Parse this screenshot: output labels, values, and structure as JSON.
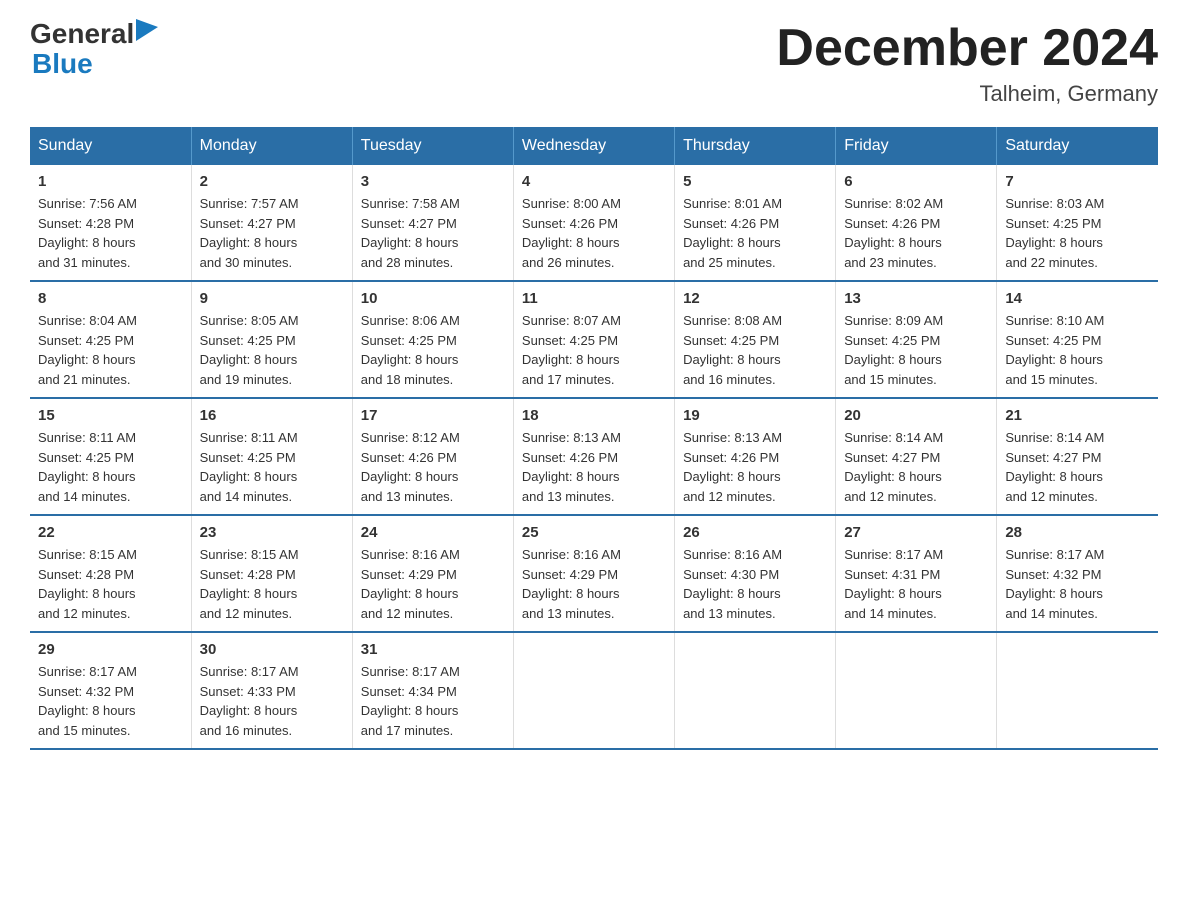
{
  "logo": {
    "general": "General",
    "blue": "Blue"
  },
  "title": "December 2024",
  "subtitle": "Talheim, Germany",
  "days_of_week": [
    "Sunday",
    "Monday",
    "Tuesday",
    "Wednesday",
    "Thursday",
    "Friday",
    "Saturday"
  ],
  "weeks": [
    [
      {
        "day": "1",
        "sunrise": "7:56 AM",
        "sunset": "4:28 PM",
        "daylight": "8 hours and 31 minutes."
      },
      {
        "day": "2",
        "sunrise": "7:57 AM",
        "sunset": "4:27 PM",
        "daylight": "8 hours and 30 minutes."
      },
      {
        "day": "3",
        "sunrise": "7:58 AM",
        "sunset": "4:27 PM",
        "daylight": "8 hours and 28 minutes."
      },
      {
        "day": "4",
        "sunrise": "8:00 AM",
        "sunset": "4:26 PM",
        "daylight": "8 hours and 26 minutes."
      },
      {
        "day": "5",
        "sunrise": "8:01 AM",
        "sunset": "4:26 PM",
        "daylight": "8 hours and 25 minutes."
      },
      {
        "day": "6",
        "sunrise": "8:02 AM",
        "sunset": "4:26 PM",
        "daylight": "8 hours and 23 minutes."
      },
      {
        "day": "7",
        "sunrise": "8:03 AM",
        "sunset": "4:25 PM",
        "daylight": "8 hours and 22 minutes."
      }
    ],
    [
      {
        "day": "8",
        "sunrise": "8:04 AM",
        "sunset": "4:25 PM",
        "daylight": "8 hours and 21 minutes."
      },
      {
        "day": "9",
        "sunrise": "8:05 AM",
        "sunset": "4:25 PM",
        "daylight": "8 hours and 19 minutes."
      },
      {
        "day": "10",
        "sunrise": "8:06 AM",
        "sunset": "4:25 PM",
        "daylight": "8 hours and 18 minutes."
      },
      {
        "day": "11",
        "sunrise": "8:07 AM",
        "sunset": "4:25 PM",
        "daylight": "8 hours and 17 minutes."
      },
      {
        "day": "12",
        "sunrise": "8:08 AM",
        "sunset": "4:25 PM",
        "daylight": "8 hours and 16 minutes."
      },
      {
        "day": "13",
        "sunrise": "8:09 AM",
        "sunset": "4:25 PM",
        "daylight": "8 hours and 15 minutes."
      },
      {
        "day": "14",
        "sunrise": "8:10 AM",
        "sunset": "4:25 PM",
        "daylight": "8 hours and 15 minutes."
      }
    ],
    [
      {
        "day": "15",
        "sunrise": "8:11 AM",
        "sunset": "4:25 PM",
        "daylight": "8 hours and 14 minutes."
      },
      {
        "day": "16",
        "sunrise": "8:11 AM",
        "sunset": "4:25 PM",
        "daylight": "8 hours and 14 minutes."
      },
      {
        "day": "17",
        "sunrise": "8:12 AM",
        "sunset": "4:26 PM",
        "daylight": "8 hours and 13 minutes."
      },
      {
        "day": "18",
        "sunrise": "8:13 AM",
        "sunset": "4:26 PM",
        "daylight": "8 hours and 13 minutes."
      },
      {
        "day": "19",
        "sunrise": "8:13 AM",
        "sunset": "4:26 PM",
        "daylight": "8 hours and 12 minutes."
      },
      {
        "day": "20",
        "sunrise": "8:14 AM",
        "sunset": "4:27 PM",
        "daylight": "8 hours and 12 minutes."
      },
      {
        "day": "21",
        "sunrise": "8:14 AM",
        "sunset": "4:27 PM",
        "daylight": "8 hours and 12 minutes."
      }
    ],
    [
      {
        "day": "22",
        "sunrise": "8:15 AM",
        "sunset": "4:28 PM",
        "daylight": "8 hours and 12 minutes."
      },
      {
        "day": "23",
        "sunrise": "8:15 AM",
        "sunset": "4:28 PM",
        "daylight": "8 hours and 12 minutes."
      },
      {
        "day": "24",
        "sunrise": "8:16 AM",
        "sunset": "4:29 PM",
        "daylight": "8 hours and 12 minutes."
      },
      {
        "day": "25",
        "sunrise": "8:16 AM",
        "sunset": "4:29 PM",
        "daylight": "8 hours and 13 minutes."
      },
      {
        "day": "26",
        "sunrise": "8:16 AM",
        "sunset": "4:30 PM",
        "daylight": "8 hours and 13 minutes."
      },
      {
        "day": "27",
        "sunrise": "8:17 AM",
        "sunset": "4:31 PM",
        "daylight": "8 hours and 14 minutes."
      },
      {
        "day": "28",
        "sunrise": "8:17 AM",
        "sunset": "4:32 PM",
        "daylight": "8 hours and 14 minutes."
      }
    ],
    [
      {
        "day": "29",
        "sunrise": "8:17 AM",
        "sunset": "4:32 PM",
        "daylight": "8 hours and 15 minutes."
      },
      {
        "day": "30",
        "sunrise": "8:17 AM",
        "sunset": "4:33 PM",
        "daylight": "8 hours and 16 minutes."
      },
      {
        "day": "31",
        "sunrise": "8:17 AM",
        "sunset": "4:34 PM",
        "daylight": "8 hours and 17 minutes."
      },
      null,
      null,
      null,
      null
    ]
  ],
  "labels": {
    "sunrise": "Sunrise:",
    "sunset": "Sunset:",
    "daylight": "Daylight:"
  }
}
